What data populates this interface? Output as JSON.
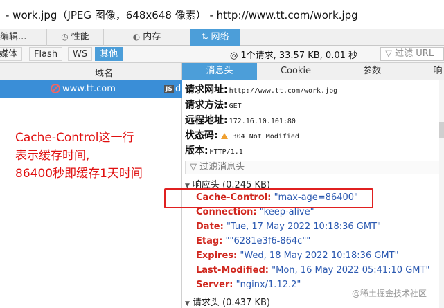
{
  "window": {
    "title": "- work.jpg（JPEG 图像，648x648 像素） - http://www.tt.com/work.jpg"
  },
  "devtools_tabs": [
    {
      "label": "编辑",
      "icon": "none"
    },
    {
      "label": "性能",
      "icon": "timer-icon"
    },
    {
      "label": "内存",
      "icon": "memory-icon"
    },
    {
      "label": "网络",
      "icon": "network-icon",
      "active": true
    }
  ],
  "filter_types": [
    {
      "label": "媒体"
    },
    {
      "label": "Flash"
    },
    {
      "label": "WS"
    },
    {
      "label": "其他",
      "selected": true
    }
  ],
  "summary": "1个请求, 33.57 KB, 0.01 秒",
  "filter_url_placeholder": "过滤 URL",
  "request_list": {
    "column_domain": "域名",
    "rows": [
      {
        "domain": "www.tt.com",
        "type_badge": "JS",
        "trailing": "d"
      }
    ]
  },
  "detail_tabs": [
    {
      "label": "消息头",
      "active": true
    },
    {
      "label": "Cookie"
    },
    {
      "label": "参数"
    },
    {
      "label": "响"
    }
  ],
  "general": [
    {
      "key": "请求网址:",
      "value": "http://www.tt.com/work.jpg"
    },
    {
      "key": "请求方法:",
      "value": "GET"
    },
    {
      "key": "远程地址:",
      "value": "172.16.10.101:80"
    },
    {
      "key": "状态码:",
      "value": "304 Not Modified",
      "status_icon": "warning-triangle"
    },
    {
      "key": "版本:",
      "value": "HTTP/1.1"
    }
  ],
  "header_filter_placeholder": "过滤消息头",
  "response_section": "响应头 (0.245 KB)",
  "response_headers": [
    {
      "key": "Cache-Control:",
      "value": "\"max-age=86400\""
    },
    {
      "key": "Connection:",
      "value": "\"keep-alive\""
    },
    {
      "key": "Date:",
      "value": "\"Tue, 17 May 2022 10:18:36 GMT\""
    },
    {
      "key": "Etag:",
      "value": "\"\"6281e3f6-864c\"\""
    },
    {
      "key": "Expires:",
      "value": "\"Wed, 18 May 2022 10:18:36 GMT\""
    },
    {
      "key": "Last-Modified:",
      "value": "\"Mon, 16 May 2022 05:41:10 GMT\""
    },
    {
      "key": "Server:",
      "value": "\"nginx/1.12.2\""
    }
  ],
  "request_section": "请求头 (0.437 KB)",
  "annotation": {
    "lines": [
      "Cache-Control这一行",
      "表示缓存时间,",
      "86400秒即缓存1天时间"
    ],
    "color": "#e01010"
  },
  "watermark": "@稀土掘金技术社区",
  "colors": {
    "accent": "#4c9ed9",
    "header_key": "#d0271e",
    "header_value": "#2a58b0"
  }
}
